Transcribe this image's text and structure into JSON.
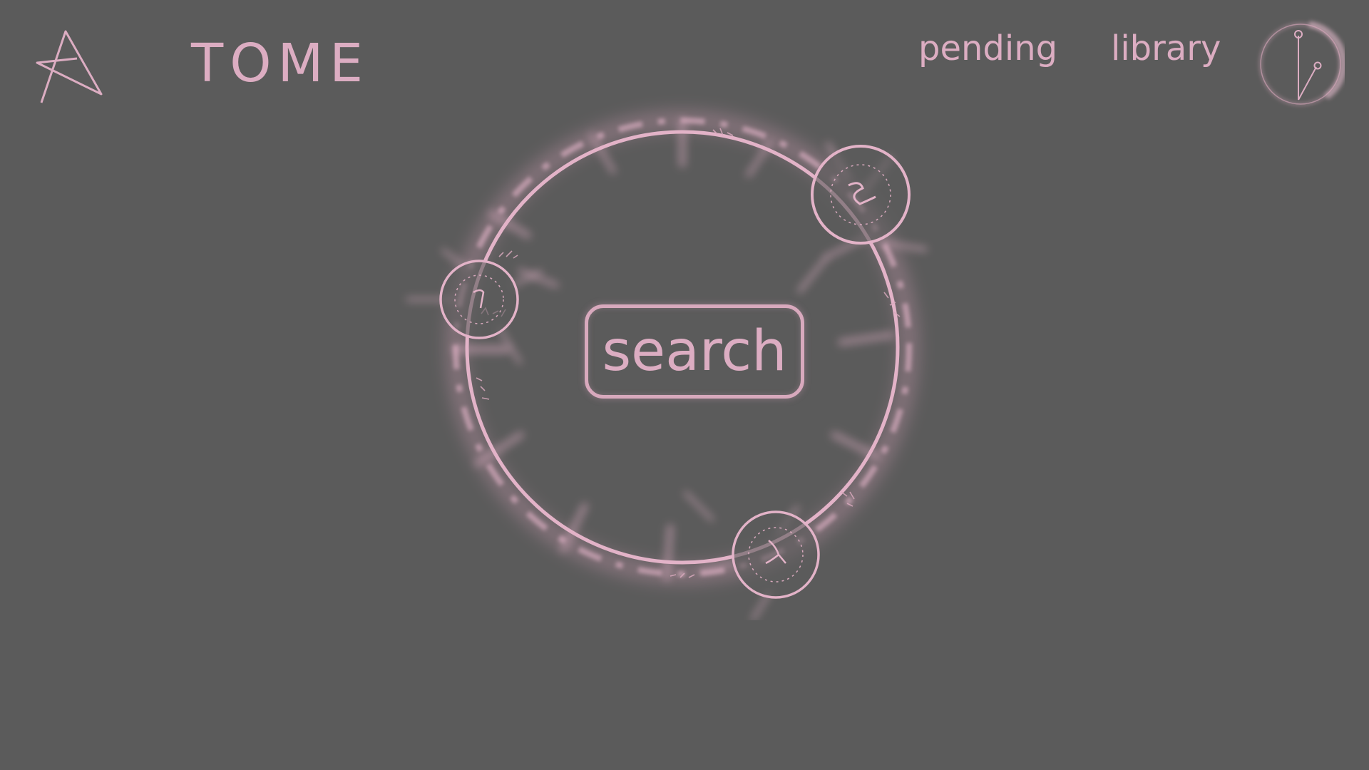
{
  "header": {
    "brand": "TOME",
    "nav": {
      "pending_label": "pending",
      "library_label": "library"
    }
  },
  "main": {
    "search_label": "search"
  },
  "icons": {
    "logo": "star-logo-icon",
    "clock": "clock-icon",
    "portal": "magic-circle-icon"
  },
  "colors": {
    "background": "#5b5b5b",
    "accent": "#dcadc2"
  }
}
